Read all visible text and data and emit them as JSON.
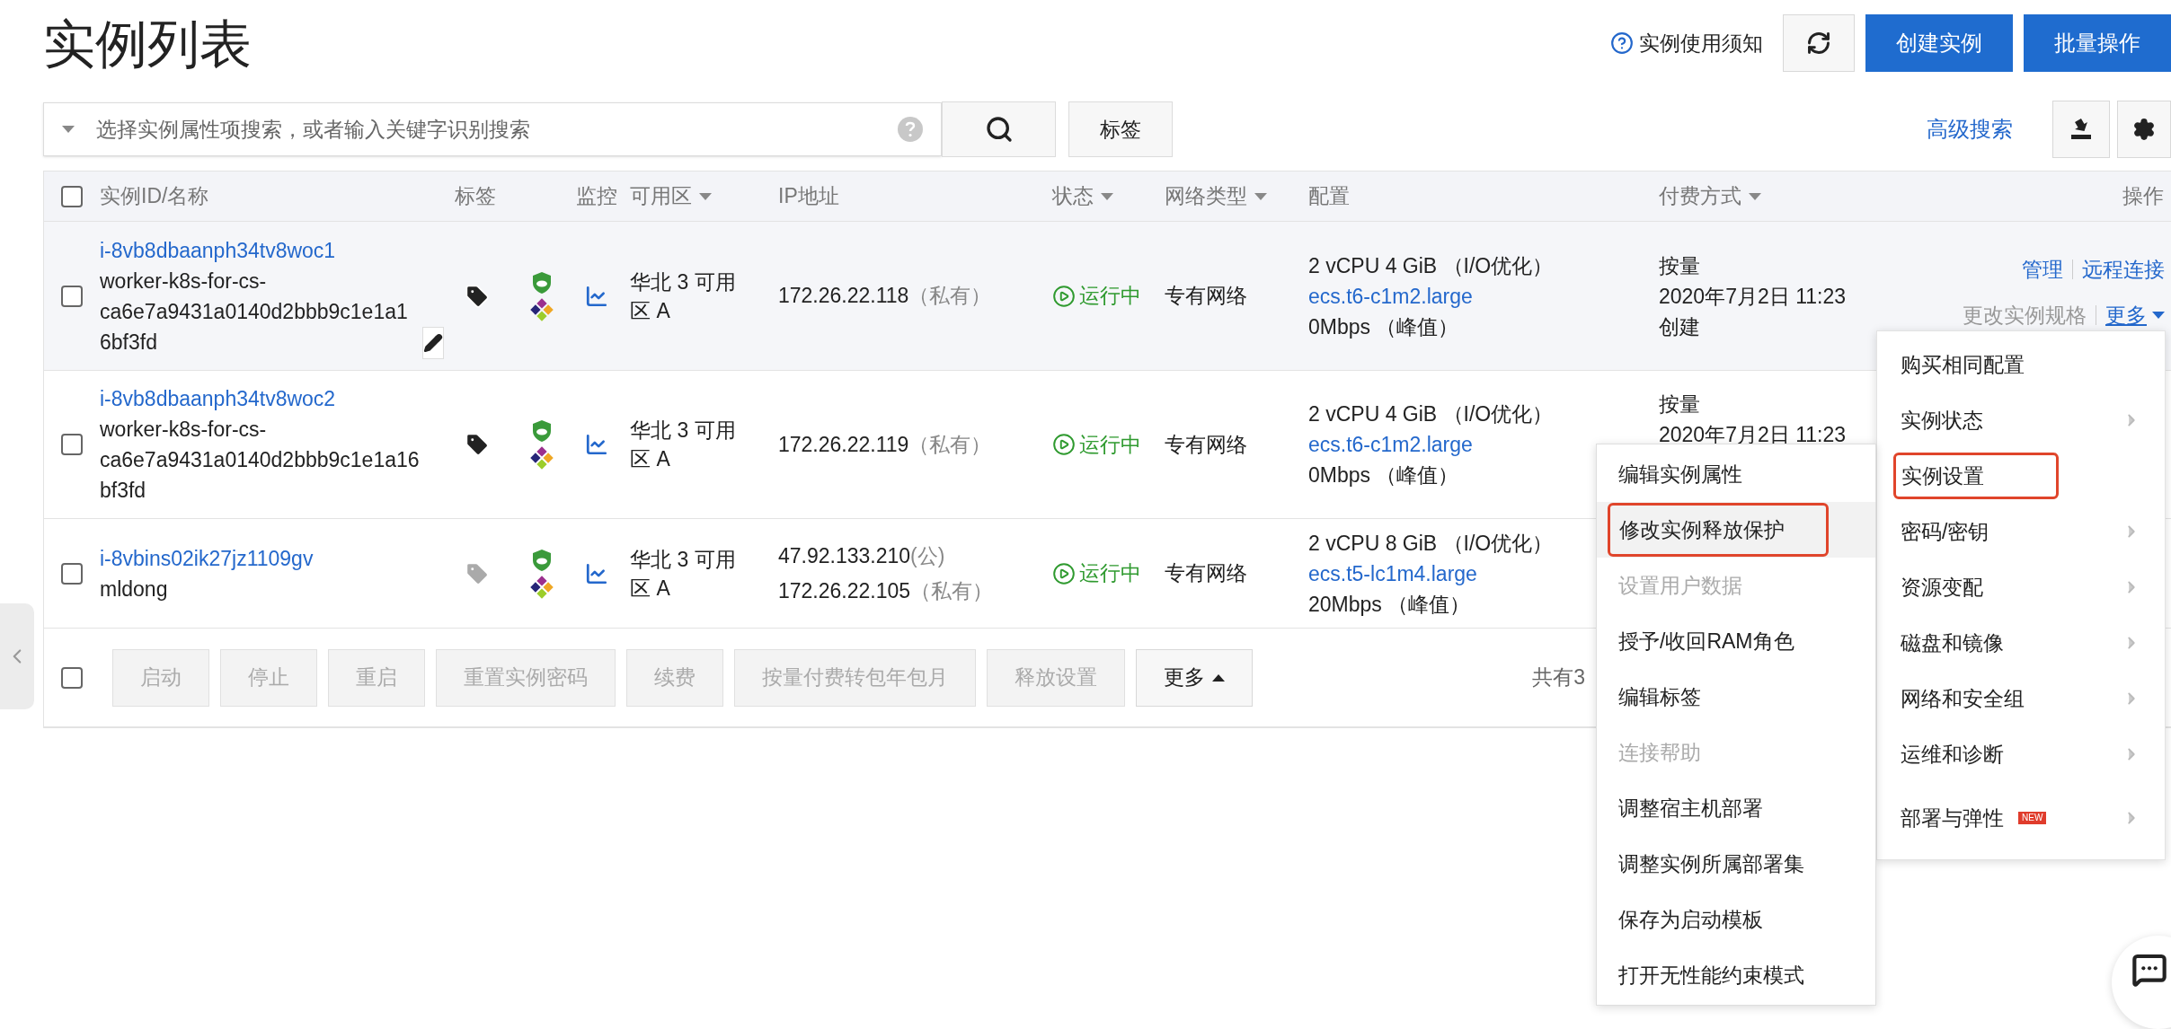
{
  "page_title": "实例列表",
  "header": {
    "notice_link": "实例使用须知",
    "buttons": [
      {
        "label": "创建实例"
      },
      {
        "label": "批量操作"
      }
    ]
  },
  "search": {
    "placeholder": "选择实例属性项搜索，或者输入关键字识别搜索",
    "tag_button": "标签",
    "advanced_search": "高级搜索"
  },
  "table": {
    "select_all_checked": false,
    "columns": [
      {
        "label": "实例ID/名称",
        "sortable": false
      },
      {
        "label": "标签",
        "sortable": false
      },
      {
        "label": "监控",
        "sortable": false
      },
      {
        "label": "可用区",
        "sortable": true
      },
      {
        "label": "IP地址",
        "sortable": false
      },
      {
        "label": "状态",
        "sortable": true
      },
      {
        "label": "网络类型",
        "sortable": true
      },
      {
        "label": "配置",
        "sortable": false
      },
      {
        "label": "付费方式",
        "sortable": true
      },
      {
        "label": "操作",
        "sortable": false
      }
    ],
    "rows": [
      {
        "checked": false,
        "highlighted": true,
        "id": "i-8vb8dbaanph34tv8woc1",
        "name": "worker-k8s-for-cs-ca6e7a9431a0140d2bbb9c1e1a16bf3fd",
        "show_edit": true,
        "tagged": true,
        "zone": "华北 3 可用区 A",
        "ips": [
          {
            "address": "172.26.22.118",
            "type": "（私有）"
          }
        ],
        "status": "运行中",
        "network": "专有网络",
        "config": {
          "spec": "2 vCPU 4 GiB （I/O优化）",
          "instance_type": "ecs.t6-c1m2.large",
          "bandwidth": "0Mbps （峰值）"
        },
        "billing": [
          "按量",
          "2020年7月2日 11:23",
          "创建"
        ],
        "actions": [
          {
            "label": "管理",
            "disabled": false
          },
          {
            "label": "远程连接",
            "disabled": false
          },
          {
            "label": "更改实例规格",
            "disabled": true
          },
          {
            "label": "更多",
            "disabled": false,
            "dropdown": true
          }
        ]
      },
      {
        "checked": false,
        "highlighted": false,
        "id": "i-8vb8dbaanph34tv8woc2",
        "name": "worker-k8s-for-cs-ca6e7a9431a0140d2bbb9c1e1a16bf3fd",
        "show_edit": false,
        "tagged": true,
        "zone": "华北 3 可用区 A",
        "ips": [
          {
            "address": "172.26.22.119",
            "type": "（私有）"
          }
        ],
        "status": "运行中",
        "network": "专有网络",
        "config": {
          "spec": "2 vCPU 4 GiB （I/O优化）",
          "instance_type": "ecs.t6-c1m2.large",
          "bandwidth": "0Mbps （峰值）"
        },
        "billing": [
          "按量",
          "2020年7月2日 11:23"
        ],
        "actions": []
      },
      {
        "checked": false,
        "highlighted": false,
        "id": "i-8vbins02ik27jz1109gv",
        "name": "mldong",
        "show_edit": false,
        "tagged": false,
        "zone": "华北 3 可用区 A",
        "ips": [
          {
            "address": "47.92.133.210",
            "type": "(公)"
          },
          {
            "address": "172.26.22.105",
            "type": "（私有）"
          }
        ],
        "status": "运行中",
        "network": "专有网络",
        "config": {
          "spec": "2 vCPU 8 GiB （I/O优化）",
          "instance_type": "ecs.t5-lc1m4.large",
          "bandwidth": "20Mbps （峰值）"
        },
        "billing": [],
        "actions": []
      }
    ]
  },
  "footer": {
    "select_all_checked": false,
    "buttons": [
      {
        "label": "启动",
        "disabled": true
      },
      {
        "label": "停止",
        "disabled": true
      },
      {
        "label": "重启",
        "disabled": true
      },
      {
        "label": "重置实例密码",
        "disabled": true
      },
      {
        "label": "续费",
        "disabled": true
      },
      {
        "label": "按量付费转包年包月",
        "disabled": true
      },
      {
        "label": "释放设置",
        "disabled": true
      },
      {
        "label": "更多",
        "disabled": false,
        "dropdown": true
      }
    ],
    "total": "共有3"
  },
  "more_menu": {
    "items": [
      {
        "label": "购买相同配置",
        "submenu": false,
        "annotated": false
      },
      {
        "label": "实例状态",
        "submenu": true,
        "annotated": false
      },
      {
        "label": "实例设置",
        "submenu": false,
        "annotated": true
      },
      {
        "label": "密码/密钥",
        "submenu": true,
        "annotated": false
      },
      {
        "label": "资源变配",
        "submenu": true,
        "annotated": false
      },
      {
        "label": "磁盘和镜像",
        "submenu": true,
        "annotated": false
      },
      {
        "label": "网络和安全组",
        "submenu": true,
        "annotated": false
      },
      {
        "label": "运维和诊断",
        "submenu": true,
        "annotated": false
      },
      {
        "label": "部署与弹性",
        "submenu": true,
        "annotated": false,
        "badge": "NEW"
      }
    ]
  },
  "settings_submenu": {
    "items": [
      {
        "label": "编辑实例属性",
        "disabled": false,
        "hovered": false,
        "annotated": false
      },
      {
        "label": "修改实例释放保护",
        "disabled": false,
        "hovered": true,
        "annotated": true
      },
      {
        "label": "设置用户数据",
        "disabled": true,
        "hovered": false,
        "annotated": false
      },
      {
        "label": "授予/收回RAM角色",
        "disabled": false,
        "hovered": false,
        "annotated": false
      },
      {
        "label": "编辑标签",
        "disabled": false,
        "hovered": false,
        "annotated": false
      },
      {
        "label": "连接帮助",
        "disabled": true,
        "hovered": false,
        "annotated": false
      },
      {
        "label": "调整宿主机部署",
        "disabled": false,
        "hovered": false,
        "annotated": false
      },
      {
        "label": "调整实例所属部署集",
        "disabled": false,
        "hovered": false,
        "annotated": false
      },
      {
        "label": "保存为启动模板",
        "disabled": false,
        "hovered": false,
        "annotated": false
      },
      {
        "label": "打开无性能约束模式",
        "disabled": false,
        "hovered": false,
        "annotated": false
      }
    ]
  }
}
